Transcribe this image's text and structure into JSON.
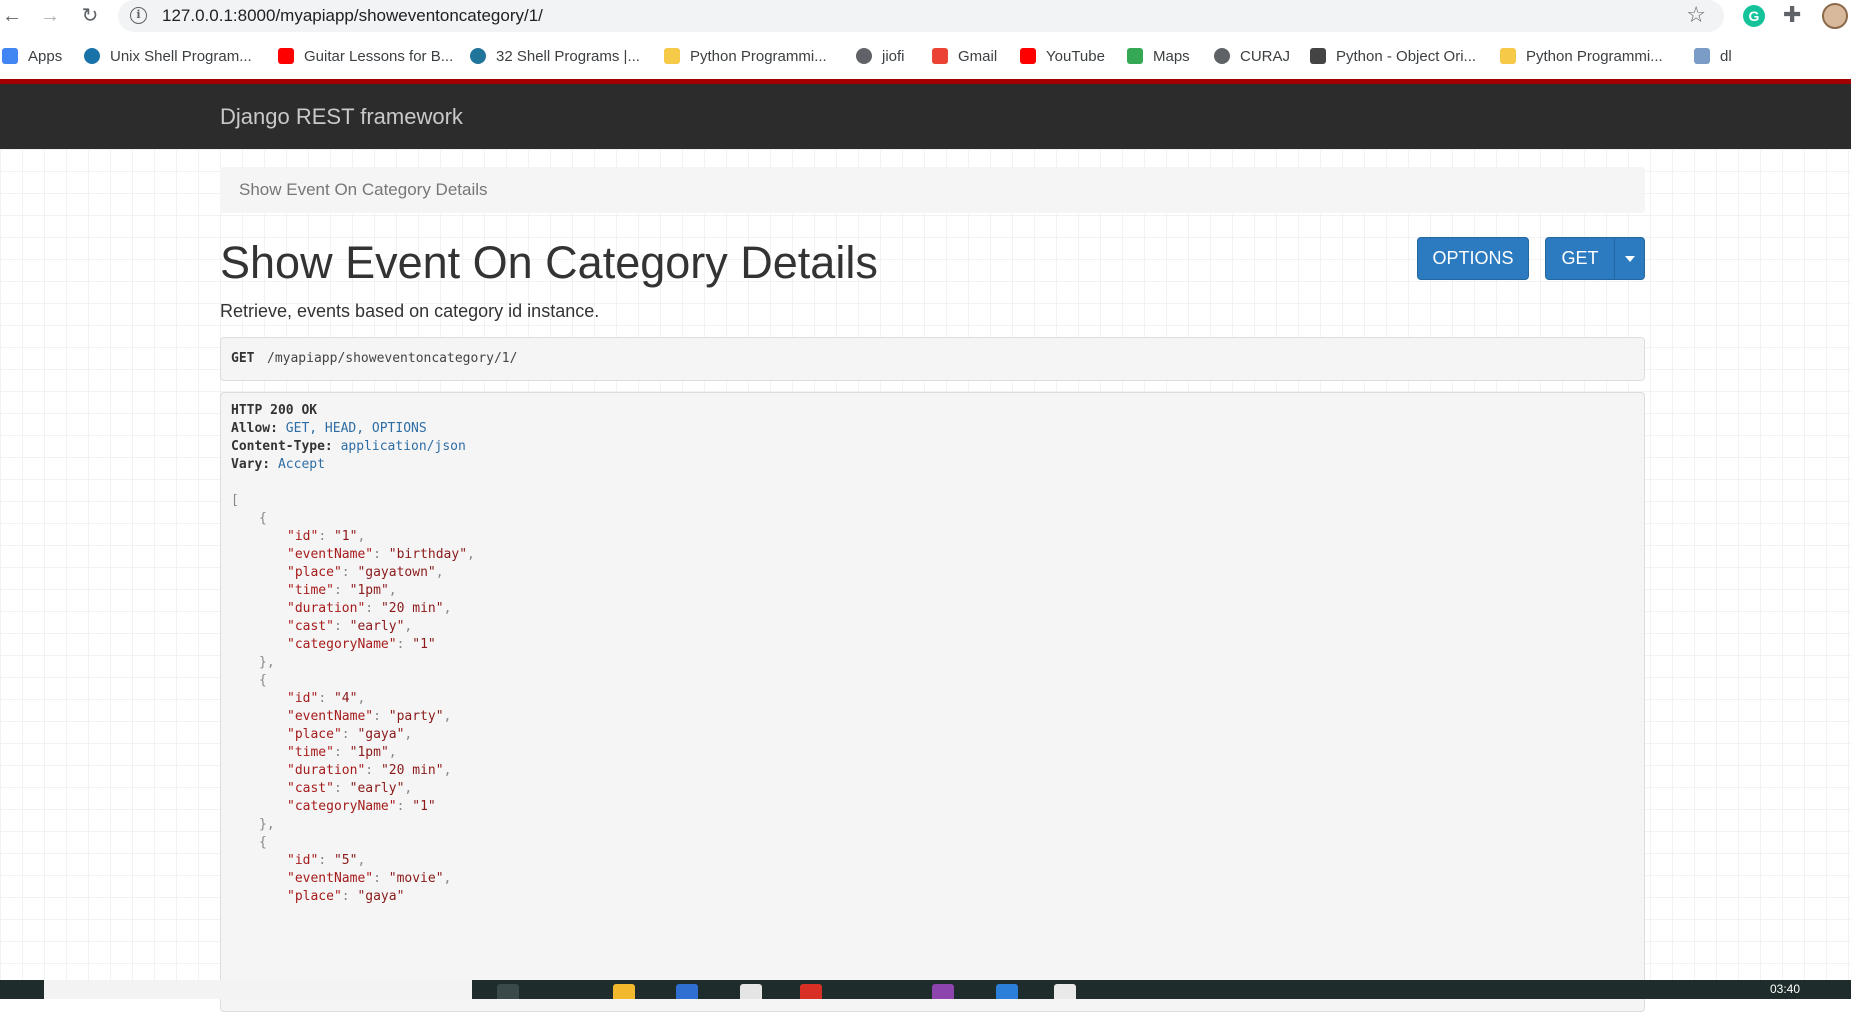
{
  "browser": {
    "url": "127.0.0.1:8000/myapiapp/showeventoncategory/1/",
    "bookmarks": [
      {
        "label": "Apps",
        "icon": "apps-grid-icon",
        "color": "#4285f4"
      },
      {
        "label": "Unix Shell Program...",
        "icon": "globe-icon",
        "color": "#1a73a8"
      },
      {
        "label": "Guitar Lessons for B...",
        "icon": "youtube-icon",
        "color": "#ff0000"
      },
      {
        "label": "32 Shell Programs |...",
        "icon": "wordpress-icon",
        "color": "#21759b"
      },
      {
        "label": "Python Programmi...",
        "icon": "python-icon",
        "color": "#f7c948"
      },
      {
        "label": "jiofi",
        "icon": "globe-icon",
        "color": "#5f6368"
      },
      {
        "label": "Gmail",
        "icon": "gmail-icon",
        "color": "#ea4335"
      },
      {
        "label": "YouTube",
        "icon": "youtube-icon",
        "color": "#ff0000"
      },
      {
        "label": "Maps",
        "icon": "maps-icon",
        "color": "#34a853"
      },
      {
        "label": "CURAJ",
        "icon": "globe-icon",
        "color": "#5f6368"
      },
      {
        "label": "Python - Object Ori...",
        "icon": "diamond-icon",
        "color": "#444444"
      },
      {
        "label": "Python Programmi...",
        "icon": "python-icon",
        "color": "#f7c948"
      },
      {
        "label": "dl",
        "icon": "image-icon",
        "color": "#7a9cc6"
      }
    ]
  },
  "navbar": {
    "brand": "Django REST framework"
  },
  "breadcrumb": {
    "label": "Show Event On Category Details"
  },
  "page": {
    "title": "Show Event On Category Details",
    "description": "Retrieve, events based on category id instance.",
    "options_label": "OPTIONS",
    "get_label": "GET"
  },
  "request": {
    "method": "GET",
    "path": "/myapiapp/showeventoncategory/1/"
  },
  "response": {
    "status": "HTTP 200 OK",
    "headers": [
      {
        "name": "Allow:",
        "value": "GET, HEAD, OPTIONS"
      },
      {
        "name": "Content-Type:",
        "value": "application/json"
      },
      {
        "name": "Vary:",
        "value": "Accept"
      }
    ],
    "events": [
      {
        "id": "1",
        "eventName": "birthday",
        "place": "gayatown",
        "time": "1pm",
        "duration": "20 min",
        "cast": "early",
        "categoryName": "1"
      },
      {
        "id": "4",
        "eventName": "party",
        "place": "gaya",
        "time": "1pm",
        "duration": "20 min",
        "cast": "early",
        "categoryName": "1"
      },
      {
        "id": "5",
        "eventName": "movie",
        "place": "gaya"
      }
    ]
  },
  "taskbar": {
    "clock": "03:40"
  },
  "colors": {
    "navbar": "#2c2c2c",
    "accent_red": "#a30000",
    "button": "#2c7bc0"
  }
}
